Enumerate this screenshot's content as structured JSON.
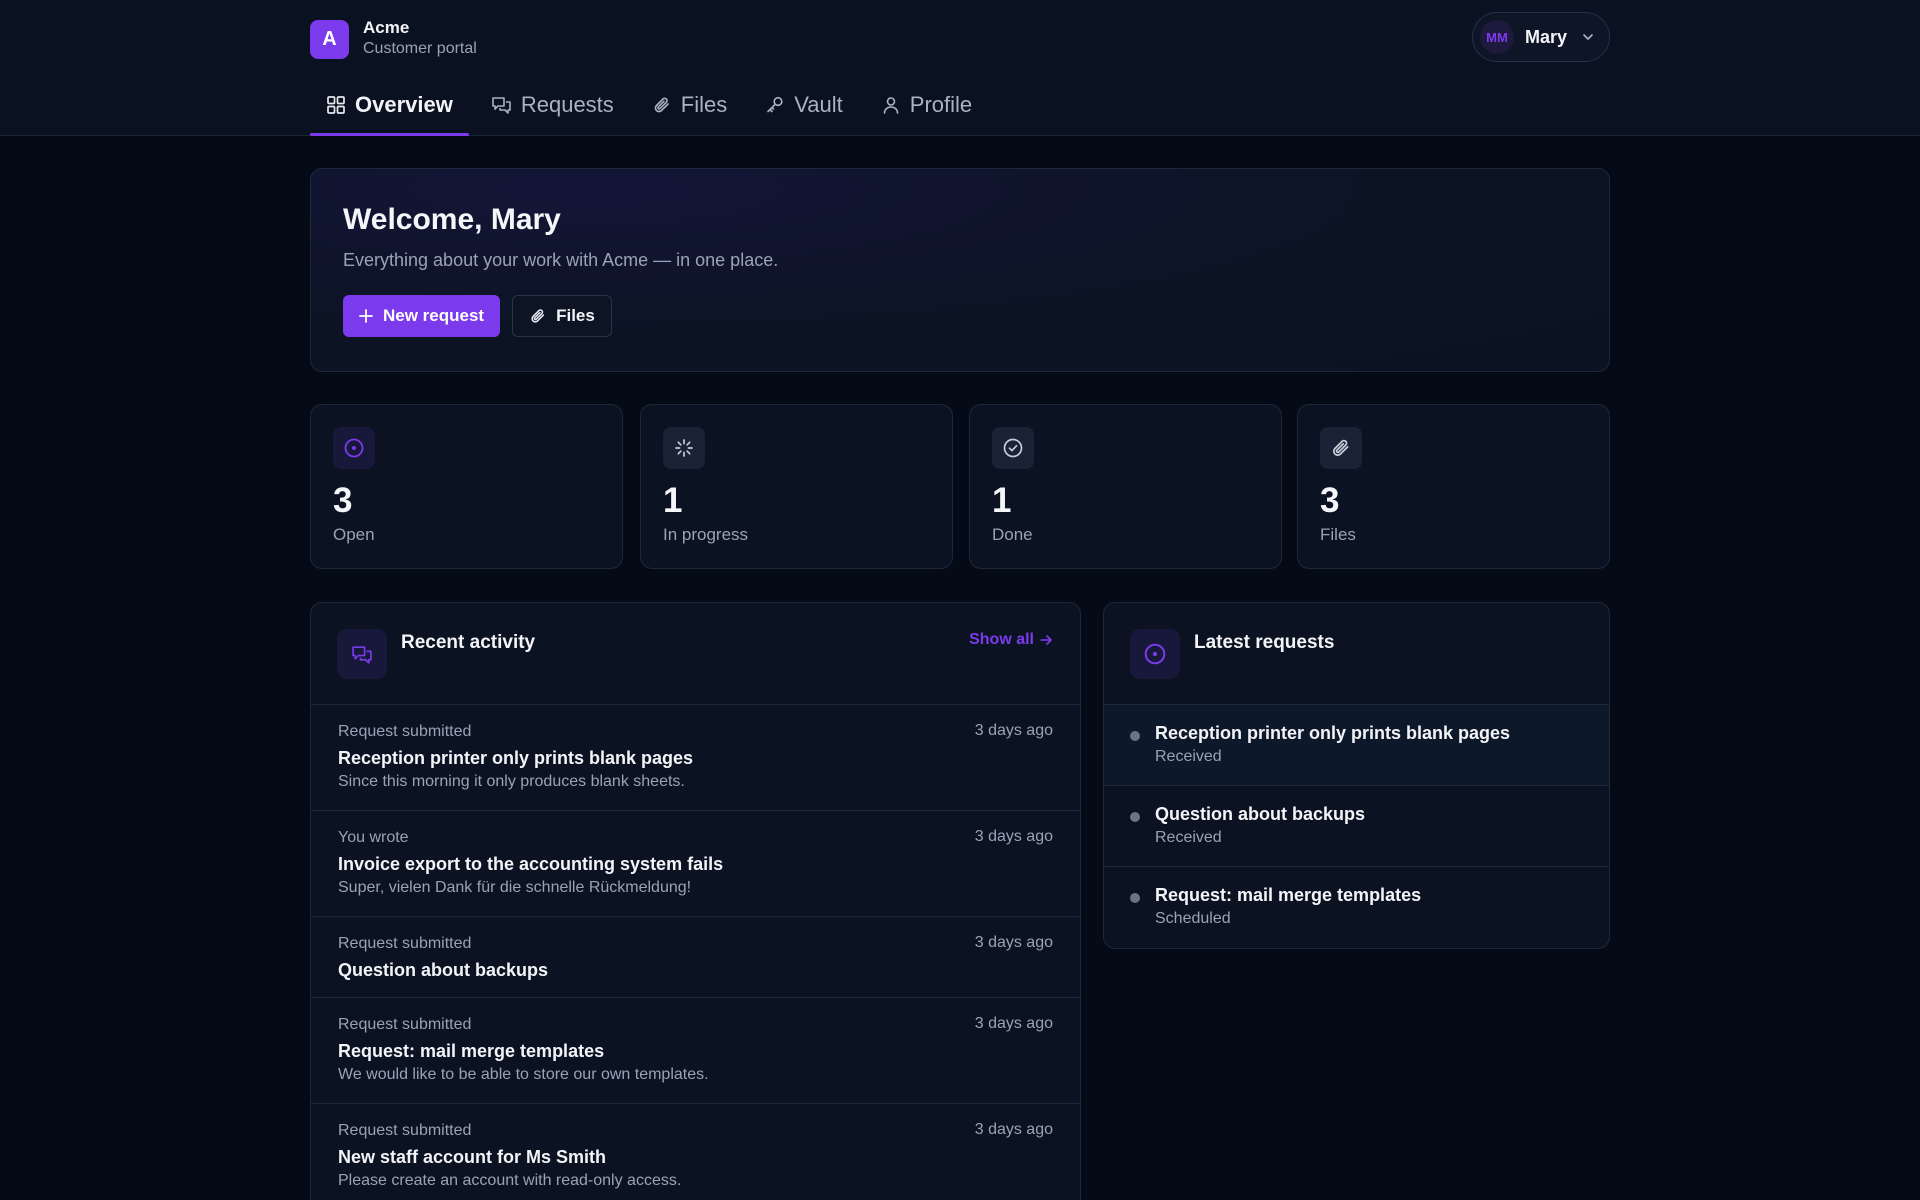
{
  "brand": {
    "logo_letter": "A",
    "name": "Acme",
    "subtitle": "Customer portal"
  },
  "user": {
    "initials": "MM",
    "name": "Mary"
  },
  "tabs": [
    {
      "label": "Overview",
      "icon": "grid-icon",
      "active": true
    },
    {
      "label": "Requests",
      "icon": "chat-icon",
      "active": false
    },
    {
      "label": "Files",
      "icon": "paperclip-icon",
      "active": false
    },
    {
      "label": "Vault",
      "icon": "key-icon",
      "active": false
    },
    {
      "label": "Profile",
      "icon": "user-icon",
      "active": false
    }
  ],
  "hero": {
    "title": "Welcome, Mary",
    "subtitle": "Everything about your work with Acme — in one place.",
    "primary_label": "New request",
    "secondary_label": "Files"
  },
  "stats": [
    {
      "value": "3",
      "label": "Open",
      "icon": "circle-dot-icon"
    },
    {
      "value": "1",
      "label": "In progress",
      "icon": "spinner-icon"
    },
    {
      "value": "1",
      "label": "Done",
      "icon": "check-circle-icon"
    },
    {
      "value": "3",
      "label": "Files",
      "icon": "paperclip-icon"
    }
  ],
  "activity": {
    "title": "Recent activity",
    "show_all": "Show all",
    "items": [
      {
        "meta": "Request submitted",
        "title": "Reception printer only prints blank pages",
        "desc": "Since this morning it only produces blank sheets.",
        "time": "3 days ago"
      },
      {
        "meta": "You wrote",
        "title": "Invoice export to the accounting system fails",
        "desc": "Super, vielen Dank für die schnelle Rückmeldung!",
        "time": "3 days ago"
      },
      {
        "meta": "Request submitted",
        "title": "Question about backups",
        "desc": "",
        "time": "3 days ago"
      },
      {
        "meta": "Request submitted",
        "title": "Request: mail merge templates",
        "desc": "We would like to be able to store our own templates.",
        "time": "3 days ago"
      },
      {
        "meta": "Request submitted",
        "title": "New staff account for Ms Smith",
        "desc": "Please create an account with read-only access.",
        "time": "3 days ago"
      }
    ]
  },
  "latest": {
    "title": "Latest requests",
    "items": [
      {
        "title": "Reception printer only prints blank pages",
        "status": "Received"
      },
      {
        "title": "Question about backups",
        "status": "Received"
      },
      {
        "title": "Request: mail merge templates",
        "status": "Scheduled"
      }
    ]
  },
  "colors": {
    "accent": "#7c3aed",
    "background": "#050b16",
    "surface": "#0b1322",
    "border": "#1e283b"
  }
}
